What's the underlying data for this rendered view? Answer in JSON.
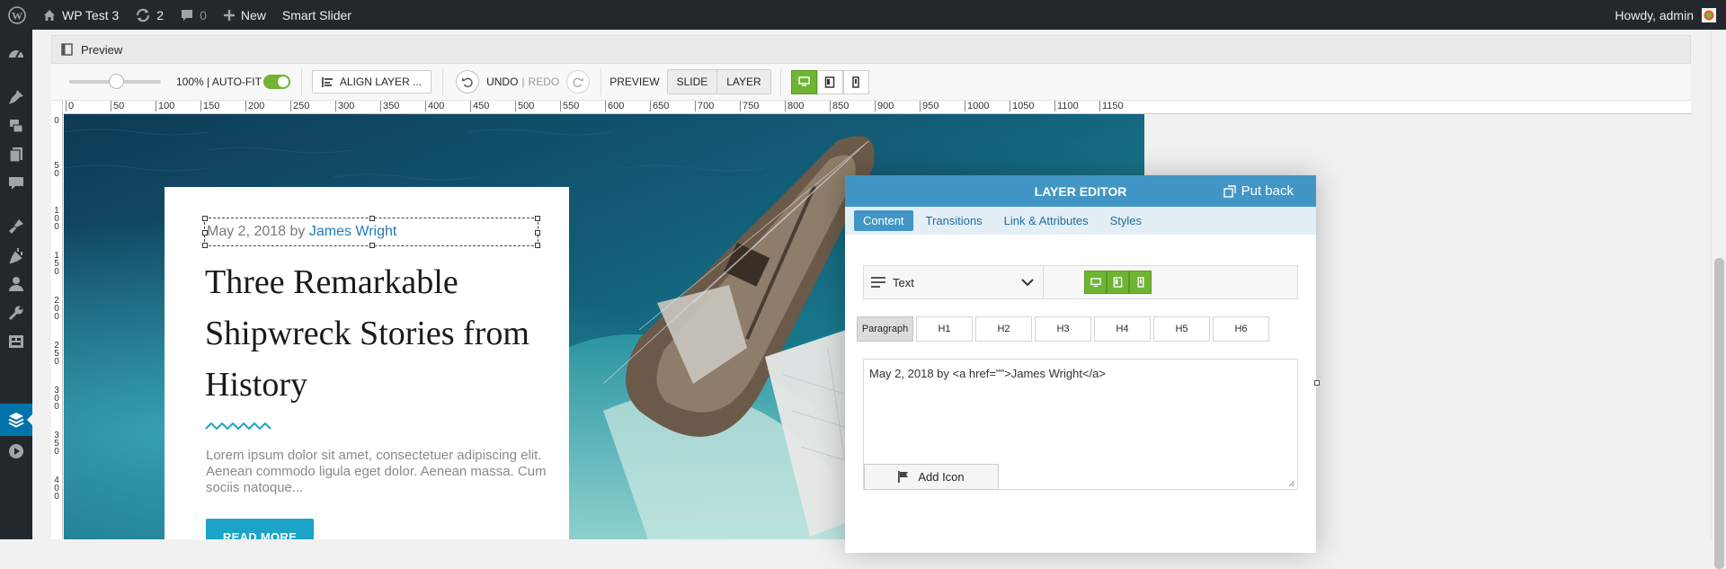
{
  "admin_bar": {
    "site_name": "WP Test 3",
    "updates_count": "2",
    "comments_count": "0",
    "new_label": "New",
    "plugin_label": "Smart Slider",
    "greeting": "Howdy, admin"
  },
  "admin_menu": {
    "icons": [
      "dashboard-icon",
      "posts-icon",
      "media-icon",
      "pages-icon",
      "comments-icon",
      "appearance-icon",
      "plugins-icon",
      "users-icon",
      "tools-icon",
      "settings-icon",
      "smart-slider-icon",
      "play-icon"
    ],
    "active": "smart-slider-icon"
  },
  "preview_bar": {
    "label": "Preview"
  },
  "toolbar": {
    "zoom_label": "100% | AUTO-FIT",
    "align_label": "ALIGN LAYER ...",
    "undo_label": "UNDO",
    "redo_label": "REDO",
    "preview_label": "PREVIEW",
    "slide_label": "SLIDE",
    "layer_label": "LAYER",
    "accent_color": "#6fb432"
  },
  "rulers": {
    "top": [
      "0",
      "50",
      "100",
      "150",
      "200",
      "250",
      "300",
      "350",
      "400",
      "450",
      "500",
      "550",
      "600",
      "650",
      "700",
      "750",
      "800",
      "850",
      "900",
      "950",
      "1000",
      "1050",
      "1100",
      "1150"
    ],
    "left": [
      "0",
      "50",
      "100",
      "150",
      "200",
      "250",
      "300",
      "350",
      "400"
    ]
  },
  "slide": {
    "meta_date": "May 2, 2018 by ",
    "meta_author": "James Wright",
    "title": "Three Remarkable Shipwreck Stories from History",
    "body": "Lorem ipsum dolor sit amet, consectetuer adipiscing elit. Aenean commodo ligula eget dolor. Aenean massa. Cum sociis natoque...",
    "button_label": "READ MORE",
    "accent_color": "#1ba4c8"
  },
  "layer_editor": {
    "title": "LAYER EDITOR",
    "put_back_label": "Put back",
    "tabs": [
      "Content",
      "Transitions",
      "Link & Attributes",
      "Styles"
    ],
    "active_tab": "Content",
    "type_value": "Text",
    "headings": [
      "Paragraph",
      "H1",
      "H2",
      "H3",
      "H4",
      "H5",
      "H6"
    ],
    "active_heading": "Paragraph",
    "text_value": "May 2, 2018 by <a href=\"\">James Wright</a>",
    "add_icon_label": "Add Icon",
    "header_color": "#4196c6"
  }
}
